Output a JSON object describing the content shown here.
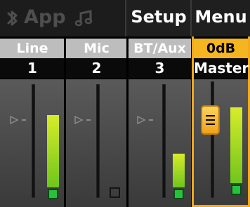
{
  "header": {
    "app_label": "App",
    "setup_label": "Setup",
    "menu_label": "Menu"
  },
  "channels": [
    {
      "label": "Line",
      "number": "1",
      "level": 0.82,
      "led": "on"
    },
    {
      "label": "Mic",
      "number": "2",
      "level": 0.0,
      "led": "off"
    },
    {
      "label": "BT/Aux",
      "number": "3",
      "level": 0.38,
      "led": "on"
    }
  ],
  "master": {
    "gain": "0dB",
    "label": "Master",
    "level": 0.86,
    "led": "on"
  },
  "colors": {
    "accent": "#f4b520",
    "meter_top": "#d8ec2a",
    "meter_bottom": "#6fc51c",
    "led_on": "#27c23c"
  },
  "icons": {
    "bluetooth": "bluetooth-icon",
    "music": "music-note-icon",
    "gain_marker": "triangle-marker-icon",
    "fader_handle": "fader-knob-icon"
  }
}
